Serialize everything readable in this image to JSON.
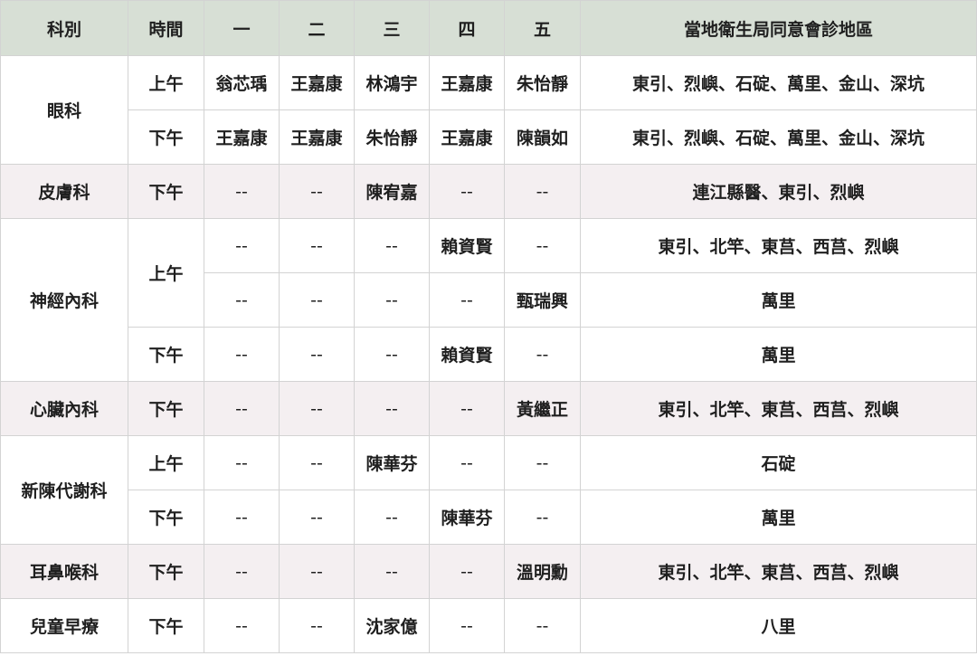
{
  "header": {
    "dept": "科別",
    "time": "時間",
    "days": [
      "一",
      "二",
      "三",
      "四",
      "五"
    ],
    "region": "當地衛生局同意會診地區"
  },
  "rows": [
    {
      "cells": [
        "上午",
        "翁芯瑀",
        "王嘉康",
        "林鴻宇",
        "王嘉康",
        "朱怡靜",
        "東引、烈嶼、石碇、萬里、金山、深坑"
      ]
    },
    {
      "cells": [
        "下午",
        "王嘉康",
        "王嘉康",
        "朱怡靜",
        "王嘉康",
        "陳韻如",
        "東引、烈嶼、石碇、萬里、金山、深坑"
      ]
    },
    {
      "cells": [
        "下午",
        "--",
        "--",
        "陳宥嘉",
        "--",
        "--",
        "連江縣醫、東引、烈嶼"
      ]
    },
    {
      "cells": [
        "--",
        "--",
        "--",
        "賴資賢",
        "--",
        "東引、北竿、東莒、西莒、烈嶼"
      ]
    },
    {
      "cells": [
        "--",
        "--",
        "--",
        "--",
        "甄瑞興",
        "萬里"
      ]
    },
    {
      "cells": [
        "下午",
        "--",
        "--",
        "--",
        "賴資賢",
        "--",
        "萬里"
      ]
    },
    {
      "cells": [
        "下午",
        "--",
        "--",
        "--",
        "--",
        "黃繼正",
        "東引、北竿、東莒、西莒、烈嶼"
      ]
    },
    {
      "cells": [
        "上午",
        "--",
        "--",
        "陳華芬",
        "--",
        "--",
        "石碇"
      ]
    },
    {
      "cells": [
        "下午",
        "--",
        "--",
        "--",
        "陳華芬",
        "--",
        "萬里"
      ]
    },
    {
      "cells": [
        "下午",
        "--",
        "--",
        "--",
        "--",
        "溫明勳",
        "東引、北竿、東莒、西莒、烈嶼"
      ]
    },
    {
      "cells": [
        "下午",
        "--",
        "--",
        "沈家億",
        "--",
        "--",
        "八里"
      ]
    }
  ],
  "departments": [
    "眼科",
    "皮膚科",
    "神經內科",
    "心臟內科",
    "新陳代謝科",
    "耳鼻喉科",
    "兒童早療"
  ],
  "neuro_am": "上午"
}
